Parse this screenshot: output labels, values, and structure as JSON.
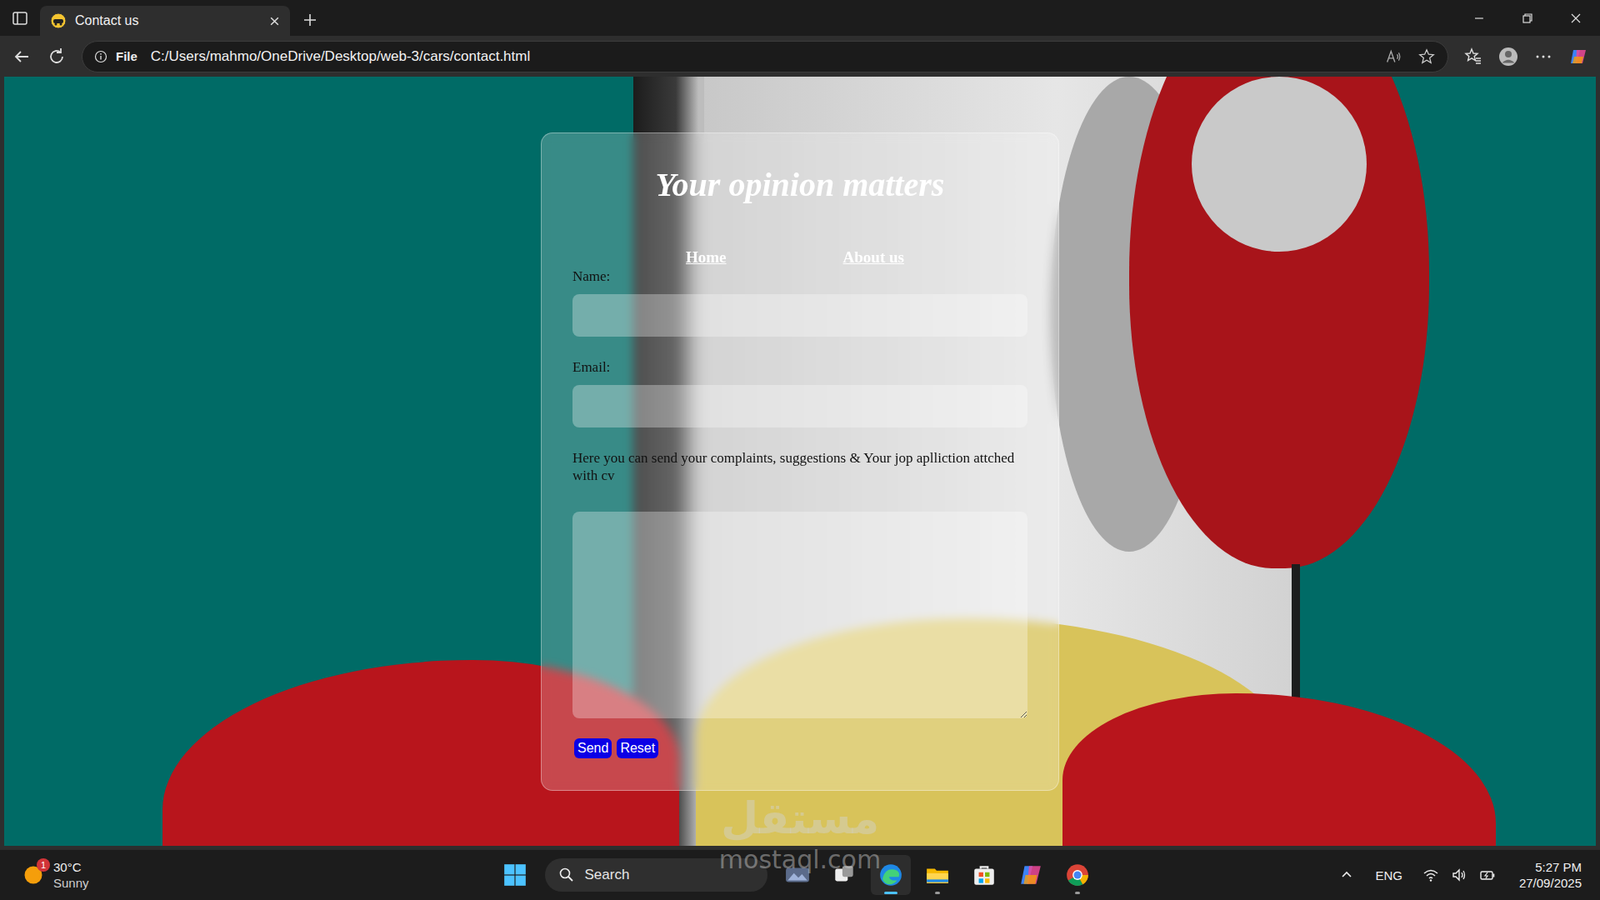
{
  "browser": {
    "tab": {
      "title": "Contact us",
      "selected": true
    },
    "address_bar": {
      "scheme": "File",
      "url": "C:/Users/mahmo/OneDrive/Desktop/web-3/cars/contact.html"
    }
  },
  "page": {
    "title": "Your opinion matters",
    "nav": [
      {
        "label": "Home"
      },
      {
        "label": "About us"
      }
    ],
    "fields": [
      {
        "label": "Name:",
        "kind": "input"
      },
      {
        "label": "Email:",
        "kind": "input"
      },
      {
        "label": "Here you can send your complaints, suggestions & Your jop aplliction attched with cv",
        "kind": "textarea"
      }
    ],
    "buttons": [
      "Send",
      "Reset"
    ]
  },
  "watermark": {
    "arabic": "مستقل",
    "latin": "mostaql.com"
  },
  "taskbar": {
    "weather": {
      "temperature": "30°C",
      "condition": "Sunny",
      "badge": "1"
    },
    "search": {
      "placeholder": "Search"
    },
    "apps": [
      {
        "kind": "widgets",
        "running": false,
        "active": false
      },
      {
        "kind": "taskview",
        "running": false,
        "active": false
      },
      {
        "kind": "edge",
        "running": true,
        "active": true
      },
      {
        "kind": "explorer",
        "running": true,
        "active": false
      },
      {
        "kind": "store",
        "running": false,
        "active": false
      },
      {
        "kind": "copilot",
        "running": false,
        "active": false
      },
      {
        "kind": "chrome",
        "running": true,
        "active": false
      }
    ],
    "tray": {
      "language": "ENG",
      "time": "5:27 PM",
      "date": "27/09/2025"
    }
  }
}
